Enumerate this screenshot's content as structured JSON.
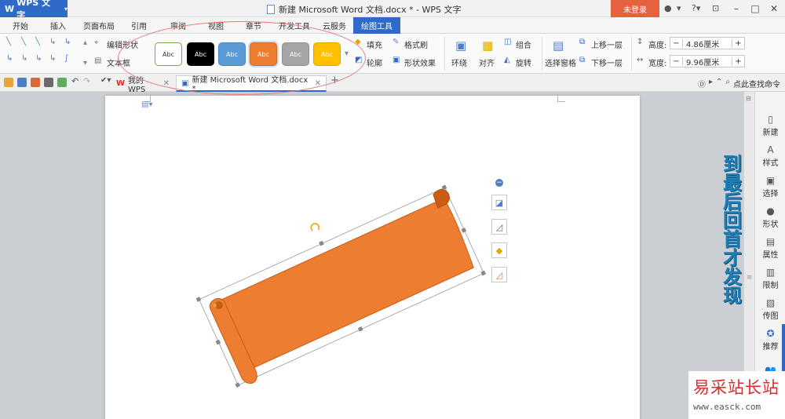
{
  "title_bar": {
    "app_menu_label": "WPS 文字",
    "window_title": "新建 Microsoft Word 文档.docx * - WPS 文字",
    "login_label": "未登录"
  },
  "menu_tabs": [
    "开始",
    "插入",
    "页面布局",
    "引用",
    "审阅",
    "视图",
    "章节",
    "开发工具",
    "云服务"
  ],
  "active_tab": "绘图工具",
  "ribbon": {
    "edit_shape": "编辑形状",
    "text_box": "文本框",
    "style_label": "Abc",
    "style_swatches": [
      {
        "bg": "#ffffff",
        "border": "#70ad47",
        "text": "#333333"
      },
      {
        "bg": "#000000",
        "border": "#000000",
        "text": "#ffffff"
      },
      {
        "bg": "#5b9bd5",
        "border": "#4a87c0",
        "text": "#ffffff"
      },
      {
        "bg": "#ed7d31",
        "border": "#d46a22",
        "text": "#ffffff"
      },
      {
        "bg": "#a5a5a5",
        "border": "#909090",
        "text": "#ffffff"
      },
      {
        "bg": "#ffc000",
        "border": "#e0a800",
        "text": "#ffffff"
      }
    ],
    "fill": "填充",
    "format_brush": "格式刷",
    "outline": "轮廓",
    "shape_effect": "形状效果",
    "wrap": "环绕",
    "align": "对齐",
    "group": "组合",
    "rotate": "旋转",
    "selection_pane": "选择窗格",
    "bring_forward": "上移一层",
    "send_backward": "下移一层",
    "height_label": "高度:",
    "height_value": "4.86厘米",
    "width_label": "宽度:",
    "width_value": "9.96厘米"
  },
  "doc_tabs": {
    "my_wps": "我的WPS",
    "current_doc": "新建 Microsoft Word 文档.docx *"
  },
  "search_cmd": "点此查找命令",
  "side_text": "到最后回首才发现",
  "right_panel": [
    "新建",
    "样式",
    "选择",
    "形状",
    "属性",
    "限制",
    "传图",
    "推荐"
  ],
  "watermark": {
    "title": "易采站长站",
    "url": "www.easck.com"
  },
  "colors": {
    "accent": "#2f6ac9",
    "shape_fill": "#ed7d31",
    "shape_dark": "#c95d14",
    "login": "#e6623e",
    "side_text": "#1e7fb8",
    "watermark_red": "#d82b2b"
  }
}
